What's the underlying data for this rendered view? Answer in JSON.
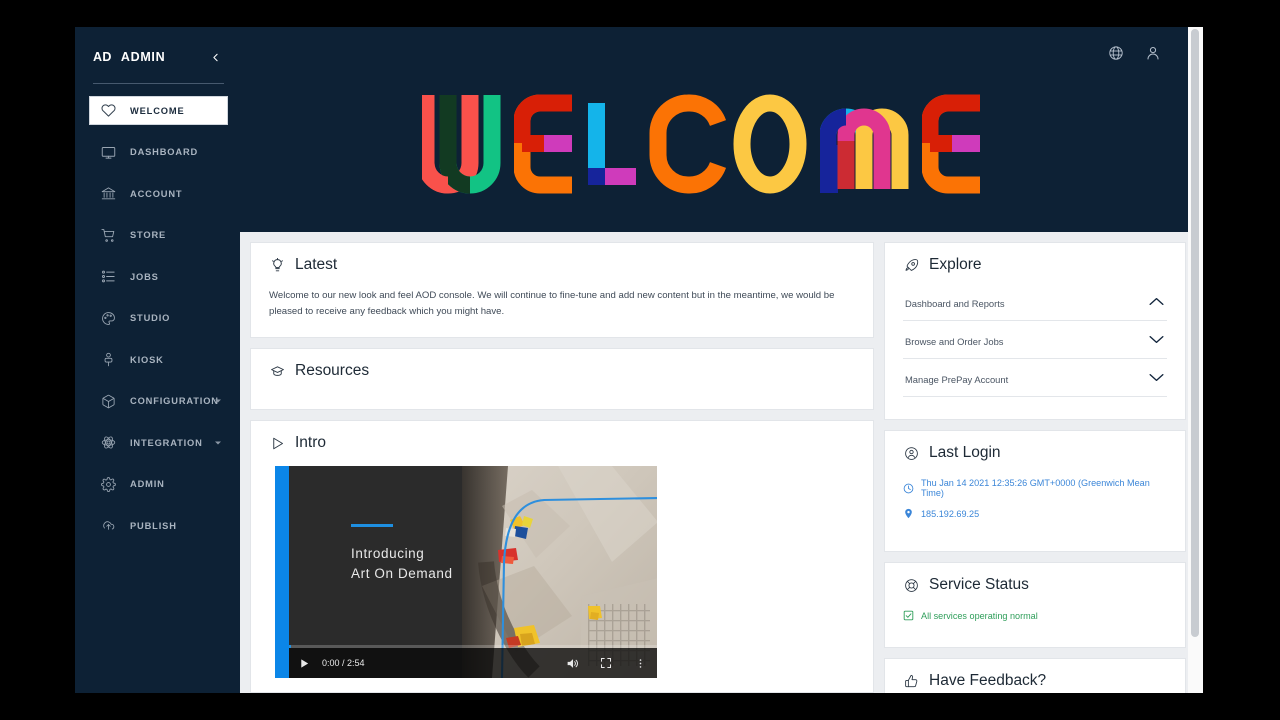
{
  "sidebar": {
    "brand_initials": "AD",
    "brand_name": "ADMIN",
    "collapse_icon": "chevron-left-icon",
    "items": [
      {
        "label": "WELCOME",
        "icon": "heart-icon",
        "active": true,
        "caret": false
      },
      {
        "label": "DASHBOARD",
        "icon": "monitor-icon",
        "active": false,
        "caret": false
      },
      {
        "label": "ACCOUNT",
        "icon": "bank-icon",
        "active": false,
        "caret": false
      },
      {
        "label": "STORE",
        "icon": "cart-icon",
        "active": false,
        "caret": false
      },
      {
        "label": "JOBS",
        "icon": "list-icon",
        "active": false,
        "caret": false
      },
      {
        "label": "STUDIO",
        "icon": "palette-icon",
        "active": false,
        "caret": false
      },
      {
        "label": "KIOSK",
        "icon": "kiosk-icon",
        "active": false,
        "caret": false
      },
      {
        "label": "CONFIGURATION",
        "icon": "cube-icon",
        "active": false,
        "caret": true
      },
      {
        "label": "INTEGRATION",
        "icon": "atom-icon",
        "active": false,
        "caret": true
      },
      {
        "label": "ADMIN",
        "icon": "gear-icon",
        "active": false,
        "caret": false
      },
      {
        "label": "PUBLISH",
        "icon": "cloud-upload-icon",
        "active": false,
        "caret": false
      }
    ]
  },
  "header": {
    "icons": [
      {
        "name": "help-globe-icon"
      },
      {
        "name": "user-account-icon"
      }
    ]
  },
  "hero": {
    "logo_text": "WELCOME",
    "background_color": "#0d2135",
    "letters": [
      {
        "char": "W",
        "colors": [
          "#f9514b",
          "#123a22",
          "#12c384"
        ]
      },
      {
        "char": "E",
        "colors": [
          "#d81f06",
          "#cf3bbb",
          "#fb7305"
        ]
      },
      {
        "char": "L",
        "colors": [
          "#14b4ea",
          "#16249b",
          "#cf3bbb"
        ]
      },
      {
        "char": "C",
        "colors": [
          "#fb7305"
        ]
      },
      {
        "char": "O",
        "colors": [
          "#fcc843"
        ]
      },
      {
        "char": "M",
        "colors": [
          "#14b4ea",
          "#16249b",
          "#e0368f",
          "#cc2b33",
          "#fcc843"
        ]
      },
      {
        "char": "E",
        "colors": [
          "#d81f06",
          "#cf3bbb",
          "#fb7305"
        ]
      }
    ]
  },
  "latest": {
    "title": "Latest",
    "icon": "lightbulb-icon",
    "body": "Welcome to our new look and feel AOD console. We will continue to fine-tune and add new content but in the meantime, we would be pleased to receive any feedback which you might have."
  },
  "resources": {
    "title": "Resources",
    "icon": "graduation-cap-icon"
  },
  "intro": {
    "title": "Intro",
    "icon": "play-triangle-icon",
    "video": {
      "slide_title": "Introducing\nArt On Demand",
      "current_time": "0:00",
      "duration": "2:54",
      "time_display": "0:00 / 2:54",
      "play_icon": "play-icon",
      "mute_icon": "volume-icon",
      "fullscreen_icon": "fullscreen-icon",
      "more_icon": "more-vertical-icon"
    }
  },
  "explore": {
    "title": "Explore",
    "icon": "rocket-icon",
    "rows": [
      {
        "label": "Dashboard and Reports",
        "chevron": "chevron-up-icon",
        "expanded": true
      },
      {
        "label": "Browse and Order Jobs",
        "chevron": "chevron-down-icon",
        "expanded": false
      },
      {
        "label": "Manage PrePay Account",
        "chevron": "chevron-down-icon",
        "expanded": false
      }
    ]
  },
  "last_login": {
    "title": "Last Login",
    "icon": "target-user-icon",
    "timestamp": "Thu Jan 14 2021 12:35:26 GMT+0000 (Greenwich Mean Time)",
    "timestamp_icon": "clock-icon",
    "ip_address": "185.192.69.25",
    "ip_icon": "map-pin-icon",
    "link_color": "#3b86d8"
  },
  "service_status": {
    "title": "Service Status",
    "icon": "lifebuoy-icon",
    "status_text": "All services operating normal",
    "status_icon": "check-square-icon",
    "status_color": "#2f9e5a"
  },
  "feedback": {
    "title": "Have Feedback?",
    "icon": "thumbs-up-icon"
  }
}
